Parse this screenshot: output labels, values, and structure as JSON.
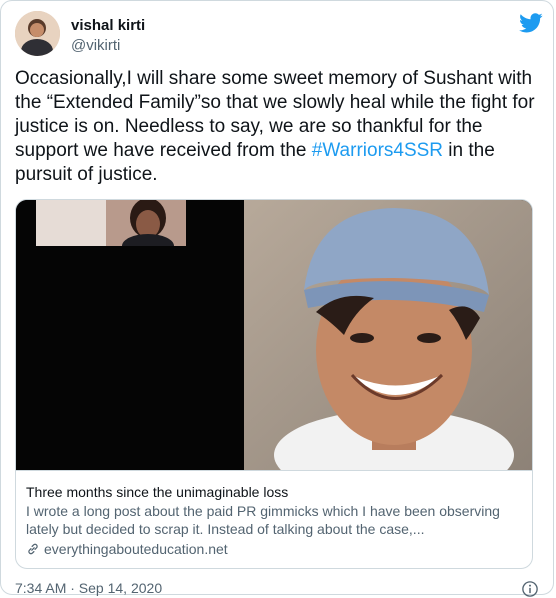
{
  "tweet": {
    "author_name": "vishal kirti",
    "author_handle": "@vikirti",
    "text_part1": "Occasionally,I will share some sweet memory of Sushant with the “Extended Family”so that we slowly heal while the fight for justice is on. Needless to say, we are so thankful for the support we have received from the ",
    "hashtag": "#Warriors4SSR",
    "text_part2": " in the pursuit of justice.",
    "timestamp": "7:34 AM · Sep 14, 2020"
  },
  "link_card": {
    "title": "Three months since the unimaginable loss",
    "description": "I wrote a long post about the paid PR gimmicks which I have been observing lately but decided to scrap it. Instead of talking about the case,...",
    "domain": "everythingabouteducation.net"
  },
  "icons": {
    "brand": "twitter-bird-icon",
    "link": "link-icon",
    "info": "info-icon"
  },
  "colors": {
    "accent": "#1d9bf0",
    "text": "#0f1419",
    "secondary_text": "#536471",
    "border": "#cfd9de"
  }
}
